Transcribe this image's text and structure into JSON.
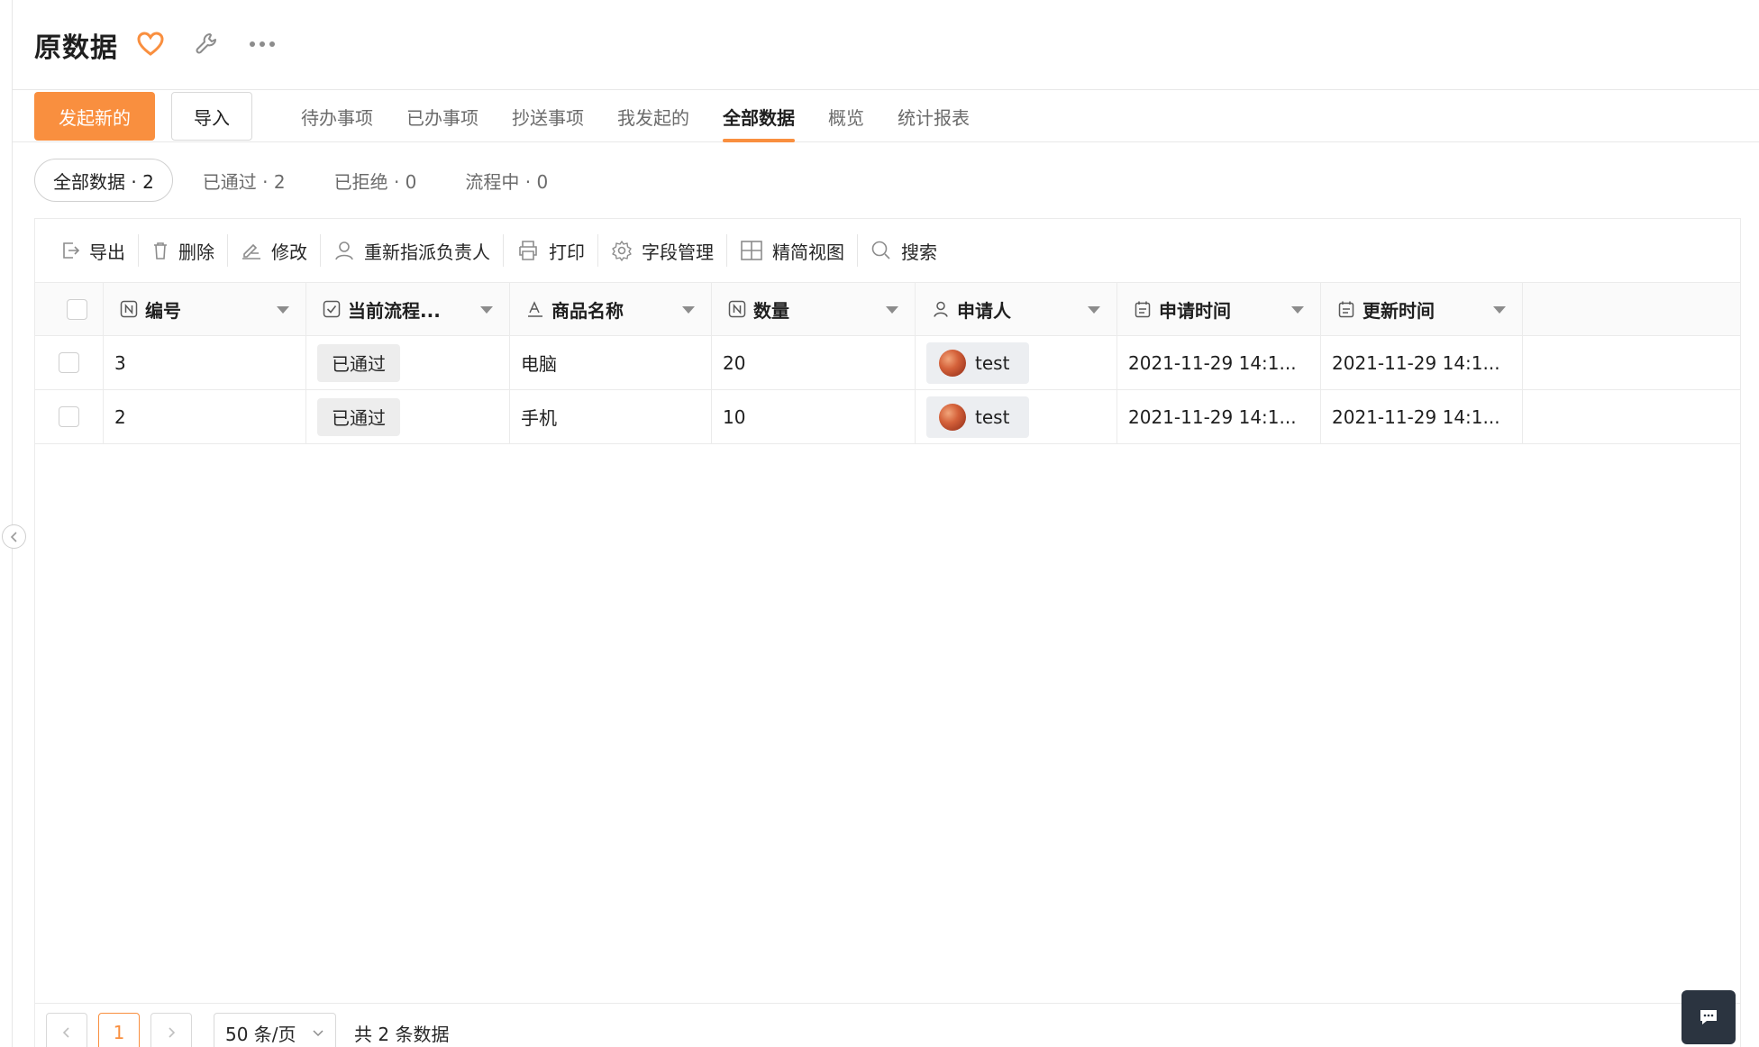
{
  "header": {
    "title": "原数据",
    "favorite_icon": "heart-icon",
    "settings_icon": "wrench-icon",
    "more_icon": "more-dots-icon",
    "accent_color": "#f98f3f"
  },
  "nav": {
    "primary_button": "发起新的",
    "import_button": "导入",
    "tabs": [
      {
        "label": "待办事项",
        "active": false
      },
      {
        "label": "已办事项",
        "active": false
      },
      {
        "label": "抄送事项",
        "active": false
      },
      {
        "label": "我发起的",
        "active": false
      },
      {
        "label": "全部数据",
        "active": true
      },
      {
        "label": "概览",
        "active": false
      },
      {
        "label": "统计报表",
        "active": false
      }
    ]
  },
  "filters": [
    {
      "label": "全部数据 · 2",
      "active": true
    },
    {
      "label": "已通过 · 2",
      "active": false
    },
    {
      "label": "已拒绝 · 0",
      "active": false
    },
    {
      "label": "流程中 · 0",
      "active": false
    }
  ],
  "toolbar": {
    "export": "导出",
    "delete": "删除",
    "edit": "修改",
    "reassign": "重新指派负责人",
    "print": "打印",
    "fields": "字段管理",
    "compact_view": "精简视图",
    "search": "搜索"
  },
  "table": {
    "columns": [
      {
        "label": "编号",
        "icon": "number-field-icon"
      },
      {
        "label": "当前流程...",
        "icon": "checkbox-field-icon"
      },
      {
        "label": "商品名称",
        "icon": "text-field-icon"
      },
      {
        "label": "数量",
        "icon": "number-field-icon"
      },
      {
        "label": "申请人",
        "icon": "user-field-icon"
      },
      {
        "label": "申请时间",
        "icon": "date-field-icon"
      },
      {
        "label": "更新时间",
        "icon": "date-field-icon"
      }
    ],
    "rows": [
      {
        "id": "3",
        "status": "已通过",
        "product": "电脑",
        "quantity": "20",
        "applicant": "test",
        "applied_at": "2021-11-29 14:1...",
        "updated_at": "2021-11-29 14:1..."
      },
      {
        "id": "2",
        "status": "已通过",
        "product": "手机",
        "quantity": "10",
        "applicant": "test",
        "applied_at": "2021-11-29 14:1...",
        "updated_at": "2021-11-29 14:1..."
      }
    ]
  },
  "pagination": {
    "prev": "<",
    "current_page": "1",
    "next": ">",
    "page_size": "50 条/页",
    "total": "共 2 条数据"
  }
}
